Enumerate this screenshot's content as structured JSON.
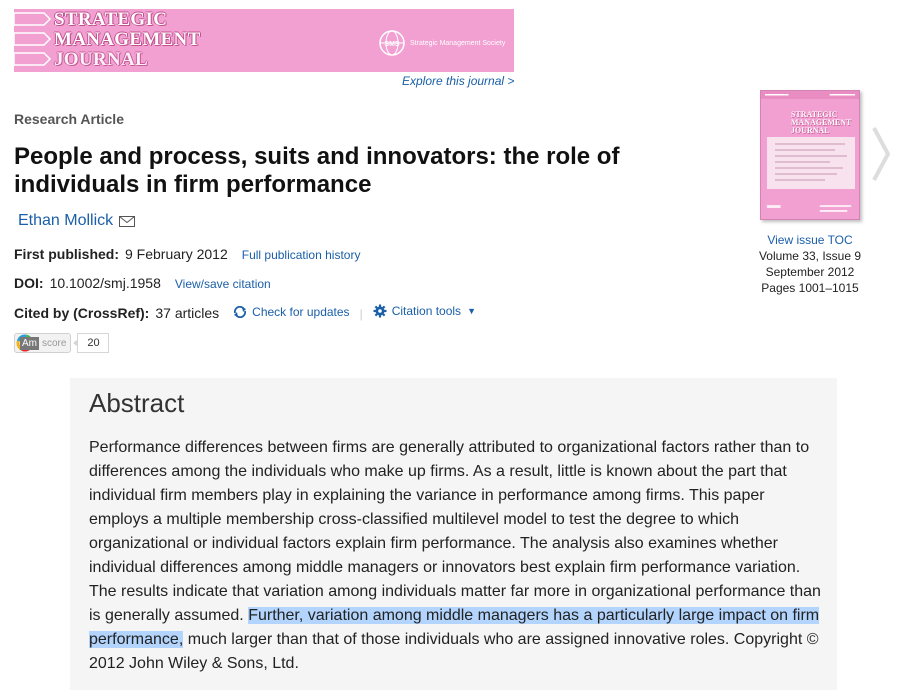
{
  "banner": {
    "title_line1": "STRATEGIC",
    "title_line2": "MANAGEMENT",
    "title_line3": "JOURNAL",
    "society_abbr": "SMS",
    "society_name": "Strategic Management Society",
    "explore_link": "Explore this journal >",
    "bg_color": "#f2a0d2"
  },
  "article": {
    "type": "Research Article",
    "title": "People and process, suits and innovators: the role of individuals in firm performance",
    "author": "Ethan Mollick",
    "first_published_label": "First published:",
    "first_published_value": "9 February 2012",
    "history_link": "Full publication history",
    "doi_label": "DOI:",
    "doi_value": "10.1002/smj.1958",
    "citation_link": "View/save citation",
    "cited_label": "Cited by (CrossRef):",
    "cited_value": "37 articles",
    "check_updates": "Check for updates",
    "citation_tools": "Citation tools",
    "altmetric_am": "Am",
    "altmetric_score_label": "score",
    "altmetric_score": "20"
  },
  "issue": {
    "cover_title_line1": "STRATEGIC",
    "cover_title_line2": "MANAGEMENT",
    "cover_title_line3": "JOURNAL",
    "view_toc": "View  issue TOC",
    "volume": "Volume 33, Issue 9",
    "date": "September 2012",
    "pages": "Pages 1001–1015"
  },
  "abstract": {
    "heading": "Abstract",
    "text_before": "Performance differences between firms are generally attributed to organizational factors rather than to differences among the individuals who make up firms. As a result, little is known about the part that individual firm members play in explaining the variance in performance among firms. This paper employs a multiple membership cross-classified multilevel model to test the degree to which organizational or individual factors explain firm performance. The analysis also examines whether individual differences among middle managers or innovators best explain firm performance variation. The results indicate that variation among individuals matter far more in organizational performance than is generally assumed. ",
    "text_highlighted": "Further, variation among middle managers has a particularly large impact on firm performance,",
    "text_after": " much larger than that of those individuals who are assigned innovative roles. Copyright © 2012 John Wiley & Sons, Ltd.",
    "highlight_color": "#b3d4fc"
  },
  "icons": {
    "mail": "mail-icon",
    "refresh": "check-updates-icon",
    "gear": "gear-icon",
    "caret": "caret-down-icon",
    "next": "chevron-right-icon",
    "donut": "altmetric-donut-icon"
  },
  "colors": {
    "link": "#1a5fa8",
    "abstract_bg": "#f5f5f5"
  }
}
